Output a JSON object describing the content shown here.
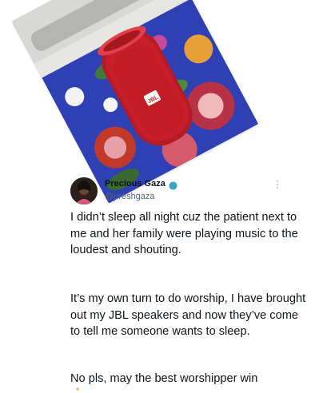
{
  "tweet": {
    "display_name": "Precious Gaza",
    "handle": "@preshgaza",
    "paragraphs": [
      "I didn’t sleep all night cuz the patient next to me and her family were playing music to the loudest and shouting.",
      "It’s my own turn to do worship, I have brought out my JBL speakers and now they’ve come to tell me someone wants to sleep.",
      "No pls, may the best worshipper win"
    ],
    "more_label": "⋮"
  },
  "photo": {
    "speaker_brand": "JBL",
    "speaker_color": "#c81e2a"
  },
  "icons": {
    "badge": "globe-icon",
    "menu": "more-icon"
  }
}
